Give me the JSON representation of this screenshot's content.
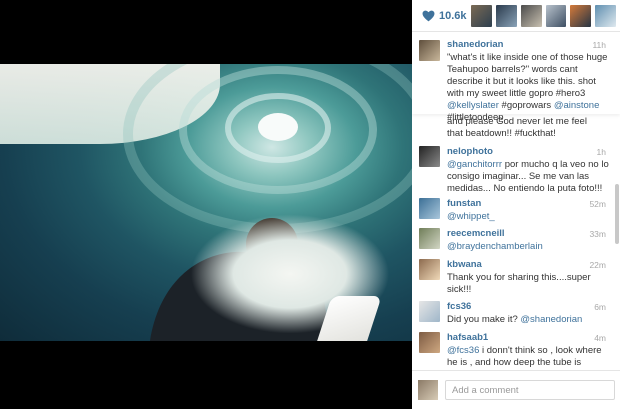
{
  "post": {
    "likes_count": "10.6k",
    "caption": {
      "username": "shanedorian",
      "time": "11h",
      "text_parts": [
        "\"what's it like inside one of those huge Teahupoo barrels?\" words cant describe it but it looks like this. shot with my sweet little gopro #hero3 ",
        "@kellyslater",
        " #goprowars ",
        "@ainstone",
        " #littletoodeep"
      ]
    },
    "partial_comment": {
      "line1": "and please God never let me feel",
      "line2": "that beatdown!! #fuckthat!"
    },
    "comments": [
      {
        "username": "nelophoto",
        "time": "1h",
        "mention": "@ganchitorrr",
        "text": " por mucho q la veo no lo consigo imaginar... Se me van las medidas... No entiendo la puta foto!!!"
      },
      {
        "username": "funstan",
        "time": "52m",
        "mention": "@whippet_",
        "text": ""
      },
      {
        "username": "reecemcneill",
        "time": "33m",
        "mention": "@braydenchamberlain",
        "text": ""
      },
      {
        "username": "kbwana",
        "time": "22m",
        "mention": "",
        "text": "Thank you for sharing this....super sick!!!"
      },
      {
        "username": "fcs36",
        "time": "6m",
        "mention": "",
        "text": "Did you make it? ",
        "mention_after": "@shanedorian"
      },
      {
        "username": "hafsaab1",
        "time": "4m",
        "mention": "@fcs36",
        "text": " i donn't think so , look where he is , and how deep the tube is"
      }
    ],
    "comment_placeholder": "Add a comment"
  },
  "colors": {
    "link": "#3f729b",
    "time": "#a8a8a8",
    "text": "#333333"
  }
}
